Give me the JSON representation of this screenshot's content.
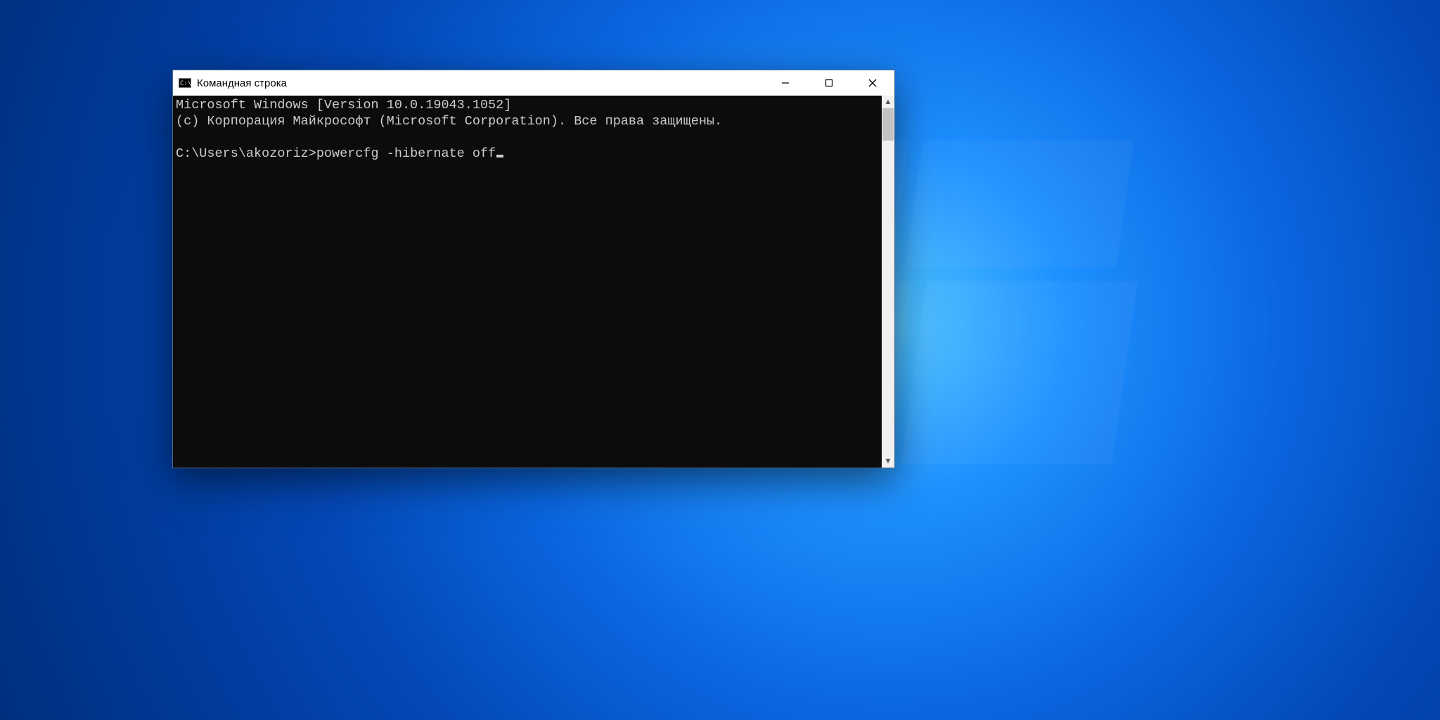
{
  "window": {
    "title": "Командная строка",
    "icon_name": "cmd-icon"
  },
  "console": {
    "line1": "Microsoft Windows [Version 10.0.19043.1052]",
    "line2": "(c) Корпорация Майкрософт (Microsoft Corporation). Все права защищены.",
    "blank": "",
    "prompt": "C:\\Users\\akozoriz>",
    "command": "powercfg -hibernate off"
  },
  "controls": {
    "minimize": "—",
    "maximize": "□",
    "close": "✕"
  }
}
